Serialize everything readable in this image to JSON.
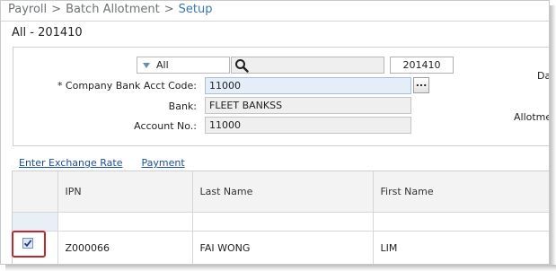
{
  "breadcrumb": {
    "items": [
      "Payroll",
      "Batch Allotment"
    ],
    "current": "Setup",
    "separator": ">"
  },
  "period_title": "All - 201410",
  "filter": {
    "selected": "All",
    "period": "201410"
  },
  "form": {
    "bank_acct_code": {
      "label": "* Company Bank Acct Code:",
      "value": "11000"
    },
    "bank": {
      "label": "Bank:",
      "value": "FLEET BANKSS"
    },
    "account_no": {
      "label": "Account No.:",
      "value": "11000"
    },
    "ellipsis_label": "...",
    "cut_labels": [
      "Da",
      "Allotme"
    ]
  },
  "tabs": [
    "Enter Exchange Rate",
    "Payment"
  ],
  "grid": {
    "columns": [
      "",
      "IPN",
      "Last Name",
      "First Name"
    ],
    "rows": [
      {
        "checked": true,
        "ipn": "Z000066",
        "last_name": "FAI WONG",
        "first_name": "LIM"
      }
    ]
  },
  "colors": {
    "link": "#1a4fa0",
    "breadcrumb_current": "#3a77b0",
    "highlight": "#c0262c",
    "required_field": "#e5eef8"
  }
}
